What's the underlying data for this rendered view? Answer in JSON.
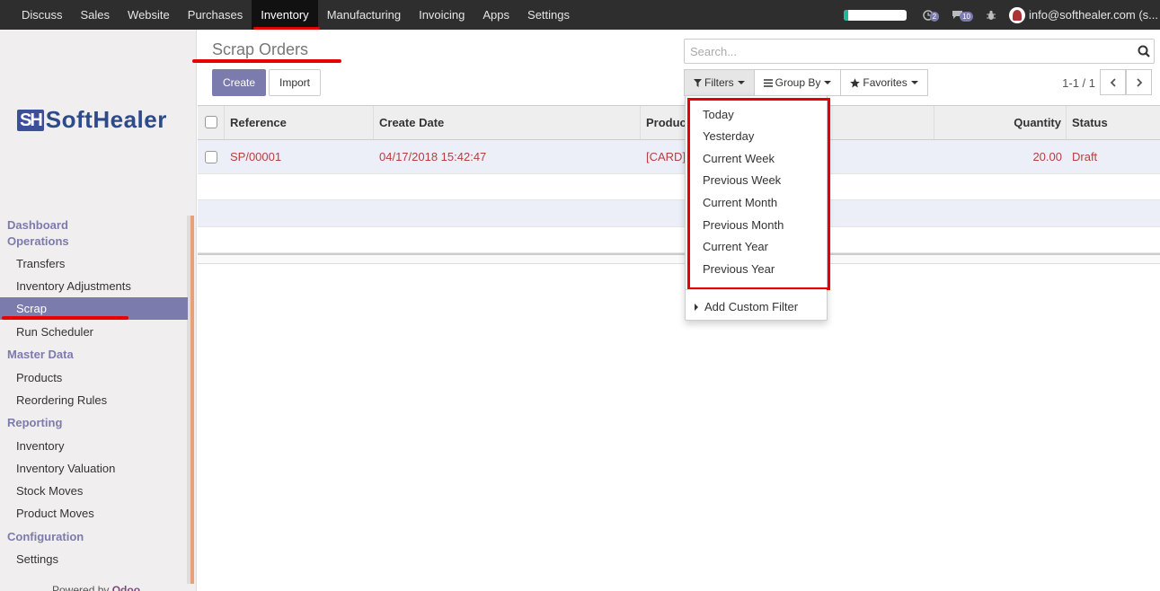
{
  "topbar": {
    "menu": [
      "Discuss",
      "Sales",
      "Website",
      "Purchases",
      "Inventory",
      "Manufacturing",
      "Invoicing",
      "Apps",
      "Settings"
    ],
    "active_menu": "Inventory",
    "activity_count": "2",
    "message_count": "10",
    "user": "info@softhealer.com (s...",
    "accent_color": "#7c7bad"
  },
  "sidebar": {
    "logo_mark": "SH",
    "logo_text": "SoftHealer",
    "sections": [
      {
        "title": "Dashboard",
        "items": []
      },
      {
        "title": "Operations",
        "items": [
          "Transfers",
          "Inventory Adjustments",
          "Scrap",
          "Run Scheduler"
        ]
      },
      {
        "title": "Master Data",
        "items": [
          "Products",
          "Reordering Rules"
        ]
      },
      {
        "title": "Reporting",
        "items": [
          "Inventory",
          "Inventory Valuation",
          "Stock Moves",
          "Product Moves"
        ]
      },
      {
        "title": "Configuration",
        "items": [
          "Settings"
        ]
      }
    ],
    "active_item": "Scrap",
    "powered_prefix": "Powered by",
    "powered_brand": "Odoo"
  },
  "main": {
    "title": "Scrap Orders",
    "create_label": "Create",
    "import_label": "Import",
    "search_placeholder": "Search...",
    "filters_label": "Filters",
    "groupby_label": "Group By",
    "favorites_label": "Favorites",
    "pager": "1-1 / 1"
  },
  "table": {
    "columns": [
      "Reference",
      "Create Date",
      "Produc",
      "Quantity",
      "Status"
    ],
    "rows": [
      {
        "reference": "SP/00001",
        "create_date": "04/17/2018 15:42:47",
        "product": "[CARD]",
        "quantity": "20.00",
        "status": "Draft"
      }
    ]
  },
  "filter_menu": {
    "items": [
      "Today",
      "Yesterday",
      "Current Week",
      "Previous Week",
      "Current Month",
      "Previous Month",
      "Current Year",
      "Previous Year"
    ],
    "custom_label": "Add Custom Filter"
  }
}
